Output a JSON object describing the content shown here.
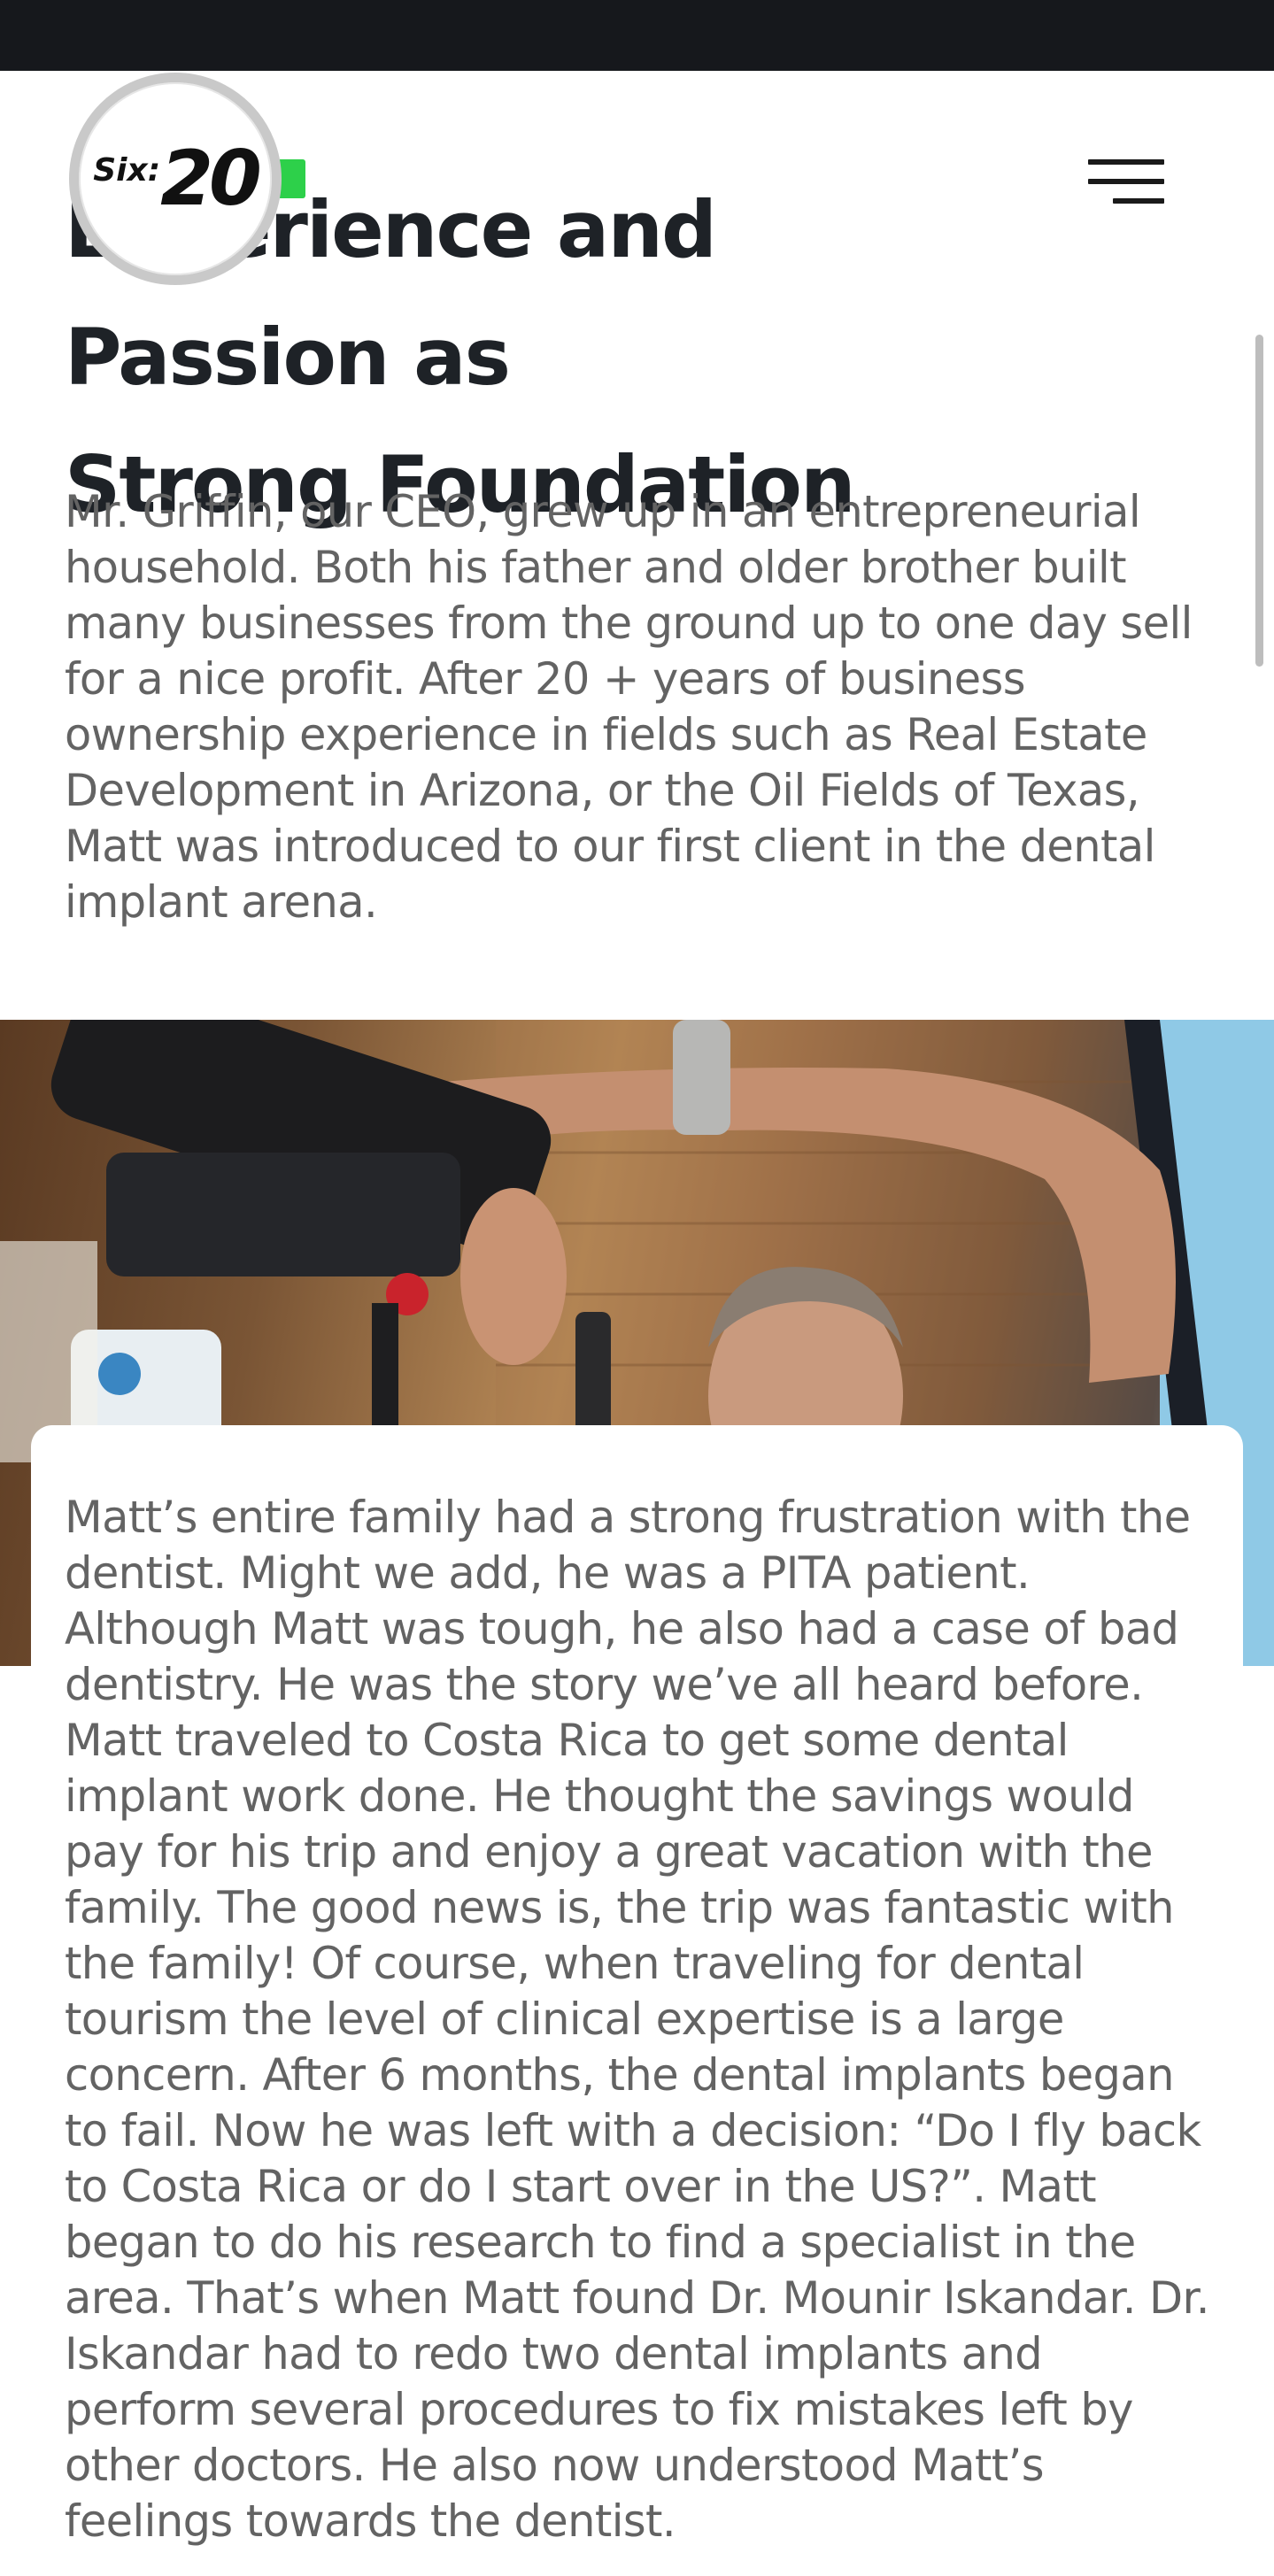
{
  "header": {
    "logo": {
      "six": "Six",
      "twenty": "20",
      "accent_color": "#2dd04a"
    },
    "menu_icon": "hamburger-menu-icon"
  },
  "section": {
    "heading_line1": "Experience and Passion as",
    "heading_line2": "Strong Foundation",
    "paragraph1": "Mr. Griffin, our CEO, grew up in an entrepreneurial household. Both his father and older brother built many businesses from the ground up to one day sell for a nice profit. After 20 + years of business ownership experience in fields such as Real Estate Development in Arizona, or the Oil Fields of Texas, Matt was introduced to our first client in the dental implant arena.",
    "paragraph2": "Matt’s entire family had a strong frustration with the dentist. Might we add, he was a PITA patient. Although Matt was tough, he also had a case of bad dentistry. He was the story we’ve all heard before. Matt traveled to Costa Rica to get some dental implant work done. He thought the savings would pay for his trip and enjoy a great vacation with the family. The good news is, the trip was fantastic with the family! Of course, when traveling for dental tourism the level of clinical expertise is a large concern. After 6 months, the dental implants began to fail. Now he was left with a decision: “Do I fly back to Costa Rica or do I start over in the US?”. Matt began to do his research to find a specialist in the area. That’s when Matt found Dr. Mounir Iskandar. Dr. Iskandar had to redo two dental implants and perform several procedures to fix mistakes left by other doctors. He also now understood Matt’s feelings towards the dentist."
  },
  "colors": {
    "heading": "#1e2227",
    "body_text": "#636363",
    "status_bar": "#16181c"
  }
}
